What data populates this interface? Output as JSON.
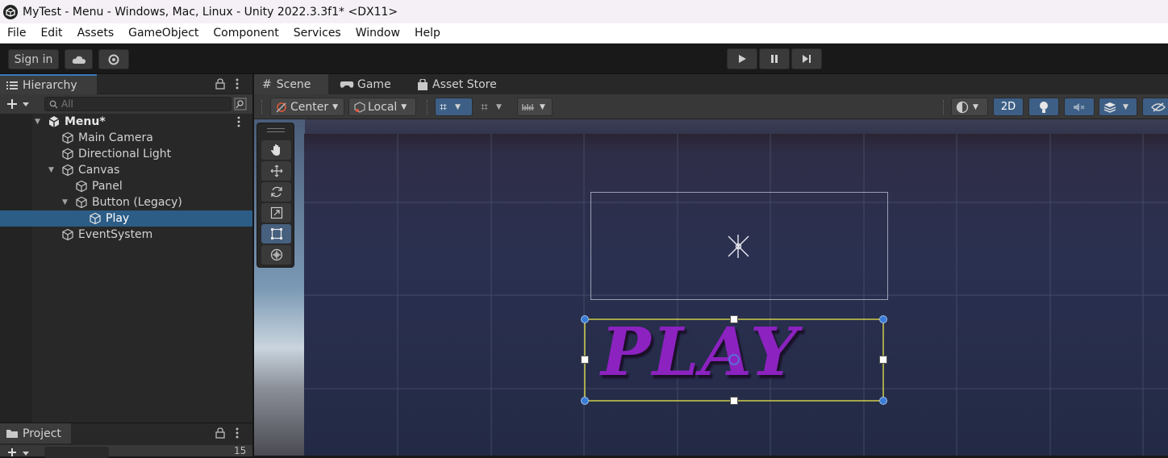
{
  "window": {
    "title": "MyTest - Menu - Windows, Mac, Linux - Unity 2022.3.3f1* <DX11>"
  },
  "menu": [
    "File",
    "Edit",
    "Assets",
    "GameObject",
    "Component",
    "Services",
    "Window",
    "Help"
  ],
  "toolbar": {
    "sign_in": "Sign in"
  },
  "hierarchy": {
    "tab": "Hierarchy",
    "search_placeholder": "All",
    "scene": "Menu*",
    "items": [
      {
        "label": "Main Camera",
        "depth": 1
      },
      {
        "label": "Directional Light",
        "depth": 1
      },
      {
        "label": "Canvas",
        "depth": 1
      },
      {
        "label": "Panel",
        "depth": 2
      },
      {
        "label": "Button (Legacy)",
        "depth": 2
      },
      {
        "label": "Play",
        "depth": 3
      },
      {
        "label": "EventSystem",
        "depth": 1
      }
    ],
    "selected": "Play"
  },
  "project": {
    "tab": "Project",
    "count": "15"
  },
  "scene_tabs": [
    "Scene",
    "Game",
    "Asset Store"
  ],
  "scene_toolbar": {
    "pivot": "Center",
    "space": "Local",
    "mode_2d": "2D"
  },
  "viewport": {
    "button_text": "PLAY"
  },
  "colors": {
    "selection": "#2c5d87",
    "accent": "#3a79bb",
    "play_text": "#8c22c0",
    "rect_outline": "#e8e84a"
  }
}
